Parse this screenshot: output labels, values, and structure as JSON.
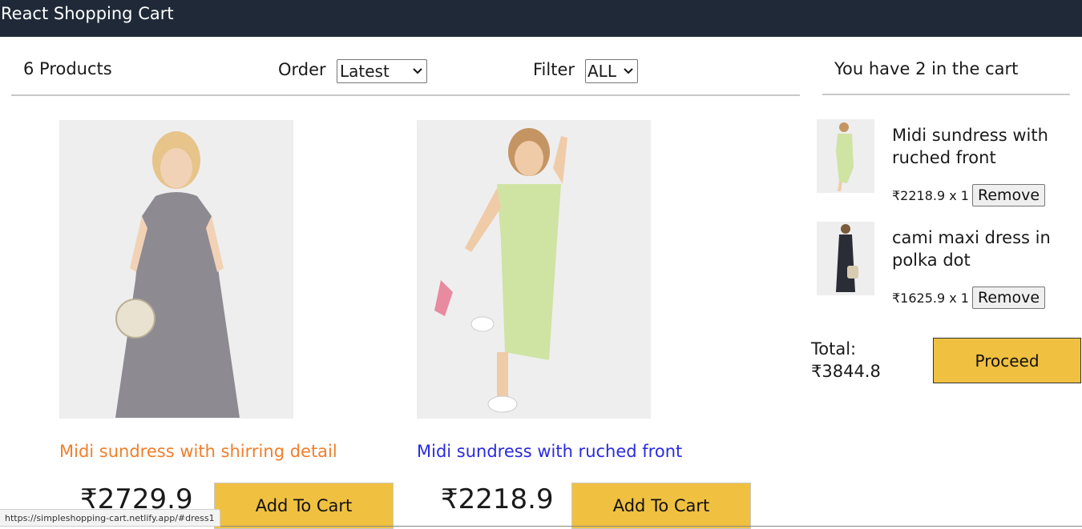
{
  "app": {
    "title": "React Shopping Cart"
  },
  "filter_bar": {
    "count_text": "6 Products",
    "order_label": "Order",
    "order_value": "Latest",
    "filter_label": "Filter",
    "filter_value": "ALL"
  },
  "products": [
    {
      "name": "Midi sundress with shirring detail",
      "price": "₹2729.9",
      "button": "Add To Cart",
      "name_color": "#f07e2b"
    },
    {
      "name": "Midi sundress with ruched front",
      "price": "₹2218.9",
      "button": "Add To Cart",
      "name_color": "#2a2adf"
    }
  ],
  "cart": {
    "header": "You have 2 in the cart",
    "items": [
      {
        "title": "Midi sundress with ruched front",
        "price": "₹2218.9 x 1",
        "remove": "Remove"
      },
      {
        "title": "cami maxi dress in polka dot",
        "price": "₹1625.9 x 1",
        "remove": "Remove"
      }
    ],
    "total_label": "Total:",
    "total_value": "₹3844.8",
    "proceed": "Proceed"
  },
  "status_bar": {
    "url": "https://simpleshopping-cart.netlify.app/#dress1"
  },
  "colors": {
    "header_bg": "#1f2937",
    "button_bg": "#f0c040"
  }
}
